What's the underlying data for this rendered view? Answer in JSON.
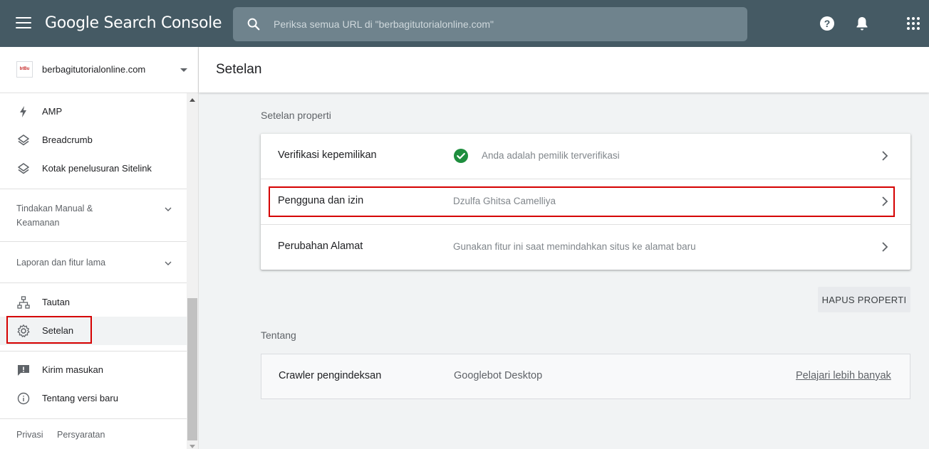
{
  "topbar": {
    "app_title": "Google Search Console",
    "search_placeholder": "Periksa semua URL di \"berbagitutorialonline.com\"",
    "icons": [
      "menu-icon",
      "search-icon",
      "help-icon",
      "bell-icon",
      "apps-grid-icon"
    ]
  },
  "sidebar": {
    "property": {
      "favicon_text": "btBu",
      "name": "berbagitutorialonline.com"
    },
    "enhancement_items": [
      {
        "label": "AMP",
        "icon": "bolt-icon"
      },
      {
        "label": "Breadcrumb",
        "icon": "layers-icon"
      },
      {
        "label": "Kotak penelusuran Sitelink",
        "icon": "layers-icon"
      }
    ],
    "sections": [
      {
        "label": "Tindakan Manual & Keamanan"
      },
      {
        "label": "Laporan dan fitur lama"
      }
    ],
    "tools_items": [
      {
        "label": "Tautan",
        "icon": "links-tree-icon"
      },
      {
        "label": "Setelan",
        "icon": "gear-icon",
        "active": true
      }
    ],
    "bottom_items": [
      {
        "label": "Kirim masukan",
        "icon": "feedback-icon"
      },
      {
        "label": "Tentang versi baru",
        "icon": "info-icon"
      }
    ],
    "footer": {
      "privacy": "Privasi",
      "terms": "Persyaratan"
    }
  },
  "main": {
    "page_title": "Setelan",
    "property_settings": {
      "heading": "Setelan properti",
      "rows": [
        {
          "label": "Verifikasi kepemilikan",
          "value": "Anda adalah pemilik terverifikasi",
          "status_icon": "check-circle-icon"
        },
        {
          "label": "Pengguna dan izin",
          "value": "Dzulfa Ghitsa Camelliya"
        },
        {
          "label": "Perubahan Alamat",
          "value": "Gunakan fitur ini saat memindahkan situs ke alamat baru"
        }
      ],
      "delete_button": "HAPUS PROPERTI"
    },
    "about": {
      "heading": "Tentang",
      "crawler_label": "Crawler pengindeksan",
      "crawler_value": "Googlebot Desktop",
      "learn_more": "Pelajari lebih banyak"
    }
  },
  "colors": {
    "topbar": "#455a64",
    "search_bg": "#6f838d",
    "highlight": "#d50000",
    "check_green": "#1e8e3e"
  }
}
